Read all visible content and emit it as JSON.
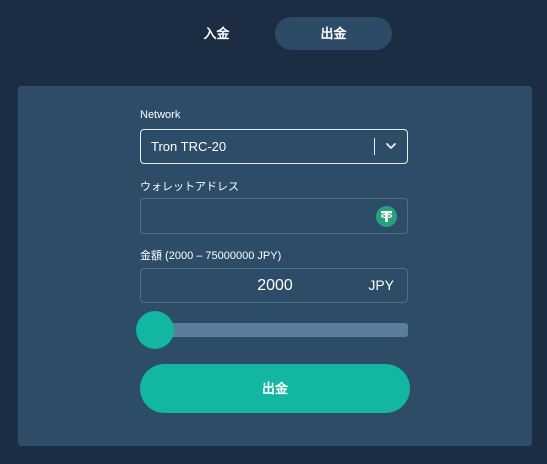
{
  "tabs": [
    {
      "label": "入金",
      "active": false
    },
    {
      "label": "出金",
      "active": true
    }
  ],
  "form": {
    "network_label": "Network",
    "network_value": "Tron TRC-20",
    "address_label": "ウォレットアドレス",
    "address_value": "",
    "address_icon": "tether-usdt-icon",
    "amount_label": "金額 (2000 – 75000000 JPY)",
    "amount_value": "2000",
    "amount_unit": "JPY",
    "slider_min": 2000,
    "slider_max": 75000000,
    "slider_value": 2000,
    "submit_label": "出金"
  },
  "colors": {
    "background": "#1b2c43",
    "panel": "#2c4c67",
    "accent": "#12b6a1",
    "tether": "#26a17b"
  }
}
